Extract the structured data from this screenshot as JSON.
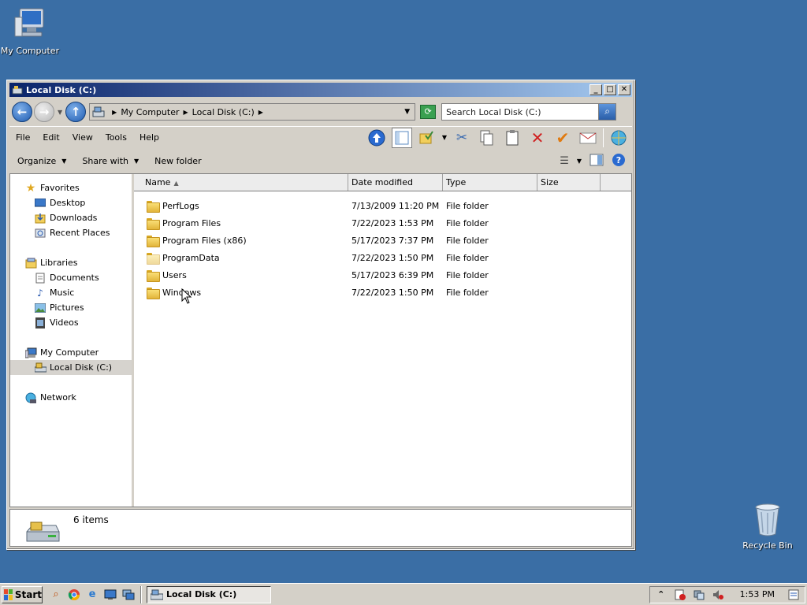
{
  "desktop": {
    "icons": [
      {
        "label": "My Computer"
      },
      {
        "label": "Recycle Bin"
      }
    ]
  },
  "window": {
    "title": "Local Disk (C:)",
    "buttons": {
      "minimize": "_",
      "maximize": "□",
      "close": "✕"
    }
  },
  "address": {
    "crumbs": [
      "My Computer",
      "Local Disk (C:)"
    ],
    "search_placeholder": "Search Local Disk (C:)"
  },
  "menu": [
    "File",
    "Edit",
    "View",
    "Tools",
    "Help"
  ],
  "commands": {
    "organize": "Organize",
    "share_with": "Share with",
    "new_folder": "New folder"
  },
  "nav": {
    "favorites": {
      "label": "Favorites",
      "items": [
        "Desktop",
        "Downloads",
        "Recent Places"
      ]
    },
    "libraries": {
      "label": "Libraries",
      "items": [
        "Documents",
        "Music",
        "Pictures",
        "Videos"
      ]
    },
    "computer": {
      "label": "My Computer",
      "items": [
        "Local Disk (C:)"
      ]
    },
    "network": {
      "label": "Network"
    }
  },
  "columns": {
    "name": "Name",
    "date": "Date modified",
    "type": "Type",
    "size": "Size"
  },
  "files": [
    {
      "name": "PerfLogs",
      "date": "7/13/2009 11:20 PM",
      "type": "File folder"
    },
    {
      "name": "Program Files",
      "date": "7/22/2023 1:53 PM",
      "type": "File folder"
    },
    {
      "name": "Program Files (x86)",
      "date": "5/17/2023 7:37 PM",
      "type": "File folder"
    },
    {
      "name": "ProgramData",
      "date": "7/22/2023 1:50 PM",
      "type": "File folder"
    },
    {
      "name": "Users",
      "date": "5/17/2023 6:39 PM",
      "type": "File folder"
    },
    {
      "name": "Windows",
      "date": "7/22/2023 1:50 PM",
      "type": "File folder"
    }
  ],
  "details": {
    "count": "6 items"
  },
  "taskbar": {
    "start": "Start",
    "task": "Local Disk (C:)",
    "clock": "1:53 PM"
  },
  "colors": {
    "desktop": "#3a6ea5",
    "title_start": "#0a246a",
    "title_end": "#a6caf0"
  }
}
